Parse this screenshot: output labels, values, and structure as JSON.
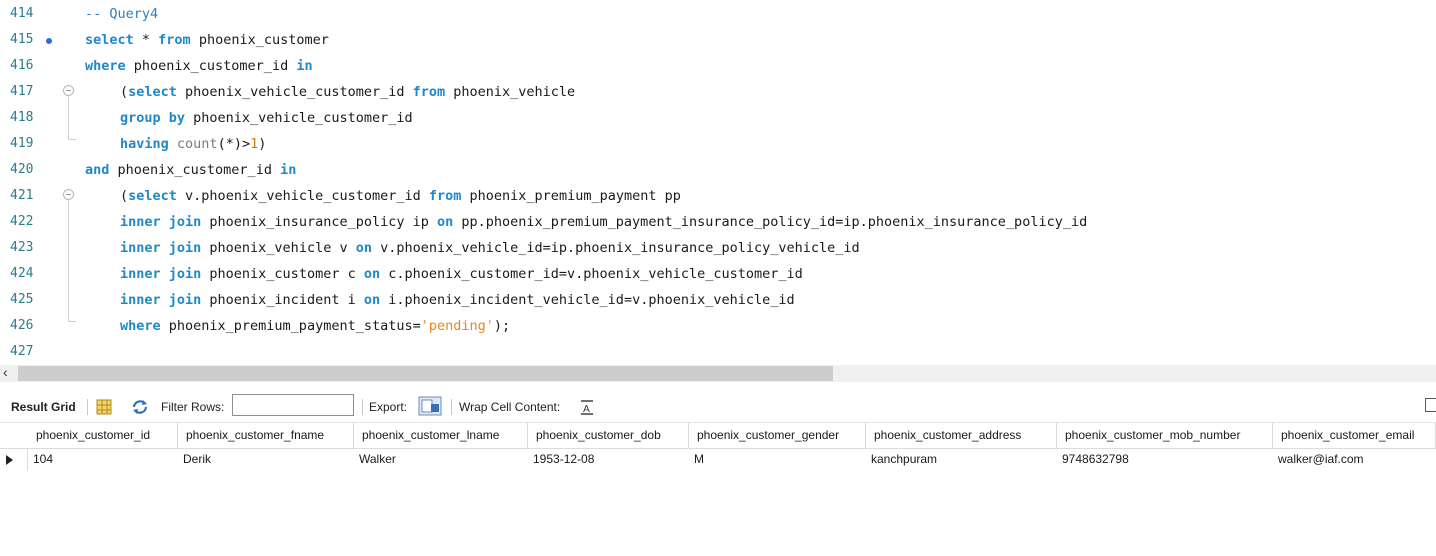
{
  "editor": {
    "lines": [
      {
        "n": "414",
        "segs": [
          {
            "t": "-- Query4",
            "c": "cm"
          }
        ]
      },
      {
        "n": "415",
        "segs": [
          {
            "t": "select",
            "c": "kw"
          },
          {
            "t": " * "
          },
          {
            "t": "from",
            "c": "kw"
          },
          {
            "t": " phoenix_customer"
          }
        ]
      },
      {
        "n": "416",
        "segs": [
          {
            "t": "where",
            "c": "kw"
          },
          {
            "t": " phoenix_customer_id "
          },
          {
            "t": "in",
            "c": "kw"
          }
        ]
      },
      {
        "n": "417",
        "segs": [
          {
            "t": "(",
            "c": ""
          },
          {
            "t": "select",
            "c": "kw"
          },
          {
            "t": " phoenix_vehicle_customer_id "
          },
          {
            "t": "from",
            "c": "kw"
          },
          {
            "t": " phoenix_vehicle"
          }
        ]
      },
      {
        "n": "418",
        "segs": [
          {
            "t": "group by",
            "c": "kw"
          },
          {
            "t": " phoenix_vehicle_customer_id"
          }
        ]
      },
      {
        "n": "419",
        "segs": [
          {
            "t": "having",
            "c": "kw"
          },
          {
            "t": " "
          },
          {
            "t": "count",
            "c": "fn"
          },
          {
            "t": "(*)>"
          },
          {
            "t": "1",
            "c": "num"
          },
          {
            "t": ")"
          }
        ]
      },
      {
        "n": "420",
        "segs": [
          {
            "t": "and",
            "c": "kw"
          },
          {
            "t": " phoenix_customer_id "
          },
          {
            "t": "in",
            "c": "kw"
          }
        ]
      },
      {
        "n": "421",
        "segs": [
          {
            "t": "("
          },
          {
            "t": "select",
            "c": "kw"
          },
          {
            "t": " v.phoenix_vehicle_customer_id "
          },
          {
            "t": "from",
            "c": "kw"
          },
          {
            "t": " phoenix_premium_payment pp"
          }
        ]
      },
      {
        "n": "422",
        "segs": [
          {
            "t": "inner join",
            "c": "kw"
          },
          {
            "t": " phoenix_insurance_policy ip "
          },
          {
            "t": "on",
            "c": "kw"
          },
          {
            "t": " pp.phoenix_premium_payment_insurance_policy_id=ip.phoenix_insurance_policy_id"
          }
        ]
      },
      {
        "n": "423",
        "segs": [
          {
            "t": "inner join",
            "c": "kw"
          },
          {
            "t": " phoenix_vehicle v "
          },
          {
            "t": "on",
            "c": "kw"
          },
          {
            "t": " v.phoenix_vehicle_id=ip.phoenix_insurance_policy_vehicle_id"
          }
        ]
      },
      {
        "n": "424",
        "segs": [
          {
            "t": "inner join",
            "c": "kw"
          },
          {
            "t": " phoenix_customer c "
          },
          {
            "t": "on",
            "c": "kw"
          },
          {
            "t": " c.phoenix_customer_id=v.phoenix_vehicle_customer_id"
          }
        ]
      },
      {
        "n": "425",
        "segs": [
          {
            "t": "inner join",
            "c": "kw"
          },
          {
            "t": " phoenix_incident i "
          },
          {
            "t": "on",
            "c": "kw"
          },
          {
            "t": " i.phoenix_incident_vehicle_id=v.phoenix_vehicle_id"
          }
        ]
      },
      {
        "n": "426",
        "segs": [
          {
            "t": "where",
            "c": "kw"
          },
          {
            "t": " phoenix_premium_payment_status="
          },
          {
            "t": "'pending'",
            "c": "str"
          },
          {
            "t": ");"
          }
        ]
      },
      {
        "n": "427",
        "segs": []
      }
    ]
  },
  "toolbar": {
    "result_grid_label": "Result Grid",
    "filter_rows_label": "Filter Rows:",
    "filter_value": "",
    "export_label": "Export:",
    "wrap_label": "Wrap Cell Content:"
  },
  "grid": {
    "columns": [
      "phoenix_customer_id",
      "phoenix_customer_fname",
      "phoenix_customer_lname",
      "phoenix_customer_dob",
      "phoenix_customer_gender",
      "phoenix_customer_address",
      "phoenix_customer_mob_number",
      "phoenix_customer_email"
    ],
    "rows": [
      [
        "104",
        "Derik",
        "Walker",
        "1953-12-08",
        "M",
        "kanchpuram",
        "9748632798",
        "walker@iaf.com"
      ]
    ]
  },
  "colors": {
    "keyword": "#1e88c9",
    "line_number": "#2a7d8c",
    "string": "#e68a1a"
  }
}
